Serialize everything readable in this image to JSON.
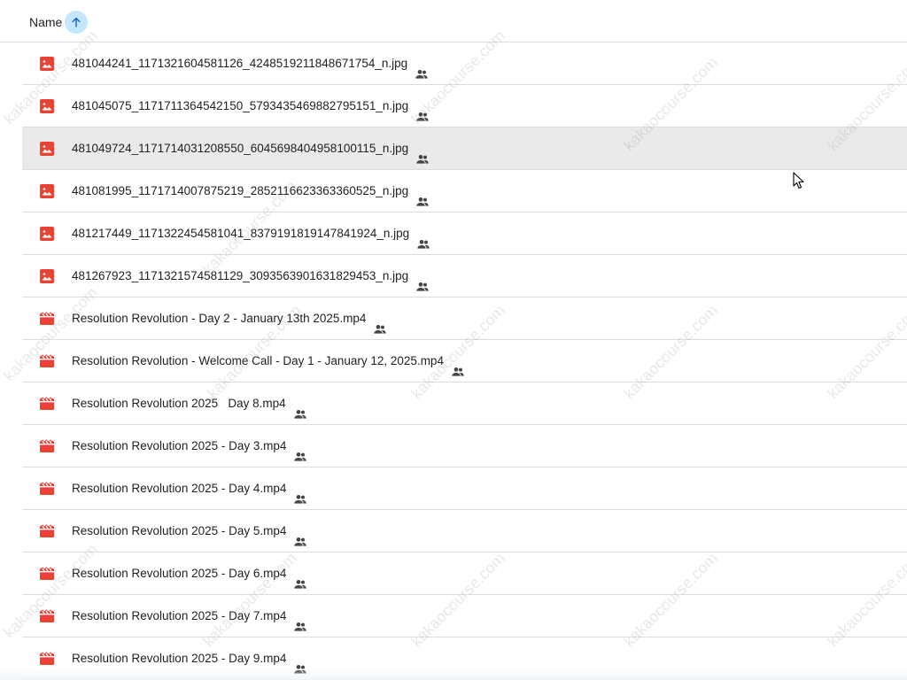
{
  "header": {
    "sort_label": "Name",
    "sort_icon": "arrow-up-icon"
  },
  "files": [
    {
      "name": "481044241_1171321604581126_4248519211848671754_n.jpg",
      "type": "image",
      "shared": true
    },
    {
      "name": "481045075_1171711364542150_5793435469882795151_n.jpg",
      "type": "image",
      "shared": true
    },
    {
      "name": "481049724_1171714031208550_6045698404958100115_n.jpg",
      "type": "image",
      "shared": true,
      "hovered": true
    },
    {
      "name": "481081995_1171714007875219_2852116623363360525_n.jpg",
      "type": "image",
      "shared": true
    },
    {
      "name": "481217449_1171322454581041_8379191819147841924_n.jpg",
      "type": "image",
      "shared": true
    },
    {
      "name": "481267923_1171321574581129_3093563901631829453_n.jpg",
      "type": "image",
      "shared": true
    },
    {
      "name": "Resolution Revolution - Day 2 - January 13th 2025.mp4",
      "type": "video",
      "shared": true
    },
    {
      "name": "Resolution Revolution - Welcome Call - Day 1 - January 12, 2025.mp4",
      "type": "video",
      "shared": true
    },
    {
      "name": "Resolution Revolution 2025   Day 8.mp4",
      "type": "video",
      "shared": true
    },
    {
      "name": "Resolution Revolution 2025 - Day 3.mp4",
      "type": "video",
      "shared": true
    },
    {
      "name": "Resolution Revolution 2025 - Day 4.mp4",
      "type": "video",
      "shared": true
    },
    {
      "name": "Resolution Revolution 2025 - Day 5.mp4",
      "type": "video",
      "shared": true
    },
    {
      "name": "Resolution Revolution 2025 - Day 6.mp4",
      "type": "video",
      "shared": true
    },
    {
      "name": "Resolution Revolution 2025 - Day 7.mp4",
      "type": "video",
      "shared": true
    },
    {
      "name": "Resolution Revolution 2025 - Day 9.mp4",
      "type": "video",
      "shared": true
    }
  ],
  "watermark": "kakaocourse.com",
  "colors": {
    "file_icon_red": "#ea4335",
    "sort_badge": "#c2e7ff",
    "sort_arrow": "#0b57d0",
    "divider": "#dadce0",
    "hover_row": "#eaeaea",
    "shared_icon": "#444746"
  }
}
